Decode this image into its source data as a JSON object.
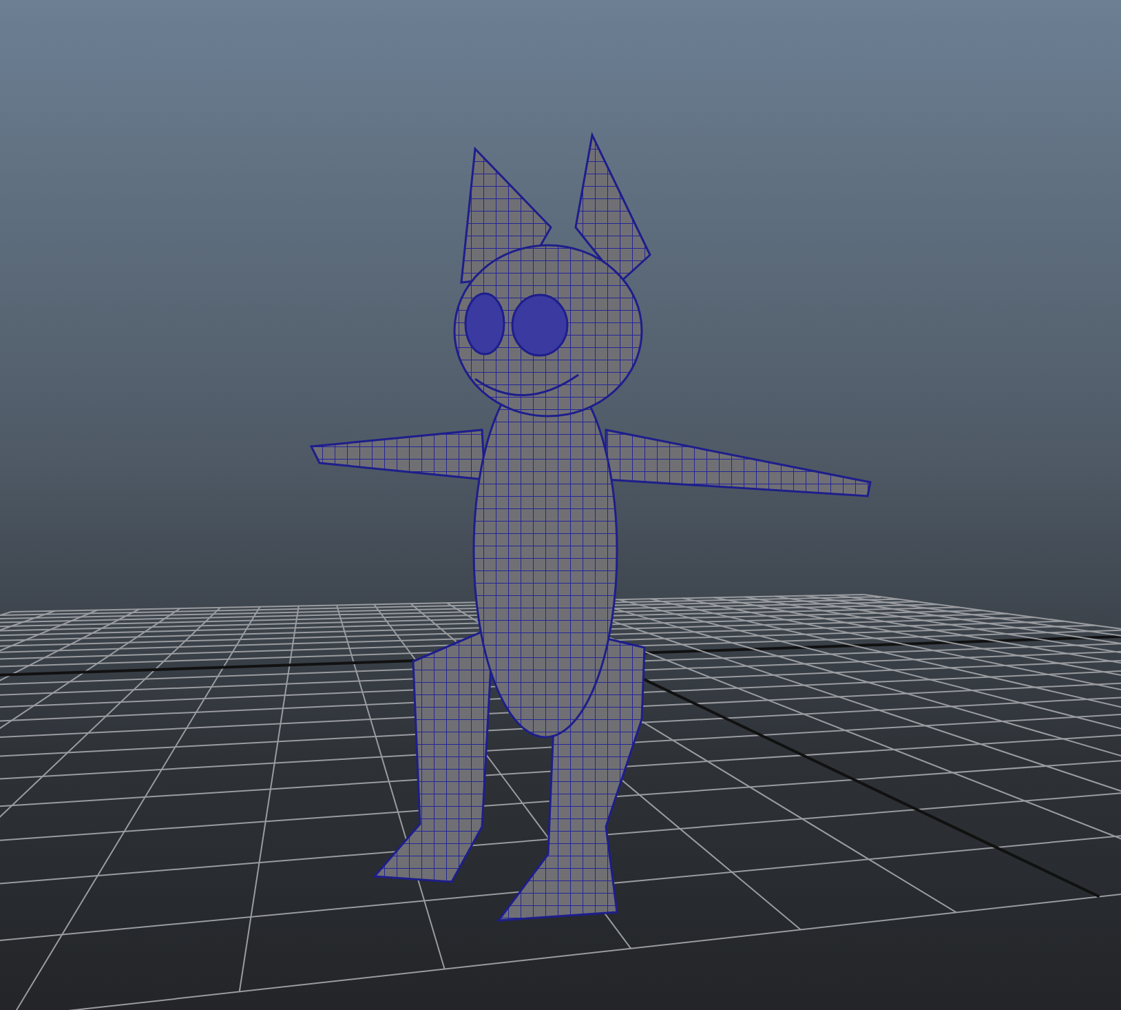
{
  "viewport": {
    "grid": true,
    "wireframe_on_shaded": true
  }
}
